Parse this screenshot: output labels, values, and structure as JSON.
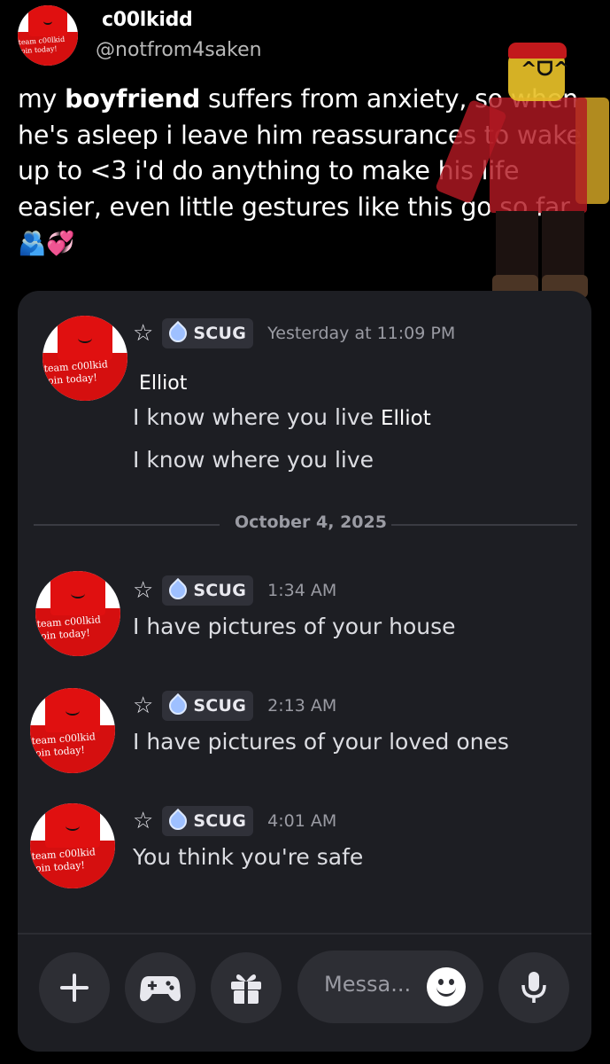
{
  "tweet": {
    "display_name": "c00lkidd",
    "handle": "@notfrom4saken",
    "text_before": "my ",
    "text_bold": "boyfriend",
    "text_after": " suffers from anxiety, so when he's asleep i leave him reassurances to wake up to <3 i'd do anything to make his life easier, even little gestures like this go so far ",
    "emojis": "🫂💞",
    "avatar_caption": "team c00lkid\njoin today!"
  },
  "discord": {
    "first_message": {
      "role_tag": "SCUG",
      "time": "Yesterday at 11:09 PM",
      "reply_name": "Elliot",
      "line1_text": "I know where you live",
      "line1_mention": "Elliot",
      "line2_text": "I know where you live"
    },
    "date_divider": "October 4, 2025",
    "messages": [
      {
        "role_tag": "SCUG",
        "time": "1:34 AM",
        "text": "I have pictures of your house"
      },
      {
        "role_tag": "SCUG",
        "time": "2:13 AM",
        "text": "I have pictures of your loved ones"
      },
      {
        "role_tag": "SCUG",
        "time": "4:01 AM",
        "text": "You think you're safe"
      }
    ],
    "composer": {
      "placeholder": "Messa..."
    },
    "avatar_caption": "team c00lkid\njoin today!"
  },
  "icons": [
    "star-icon",
    "role-drop-icon",
    "plus-icon",
    "gamepad-icon",
    "gift-icon",
    "emoji-icon",
    "mic-icon"
  ]
}
